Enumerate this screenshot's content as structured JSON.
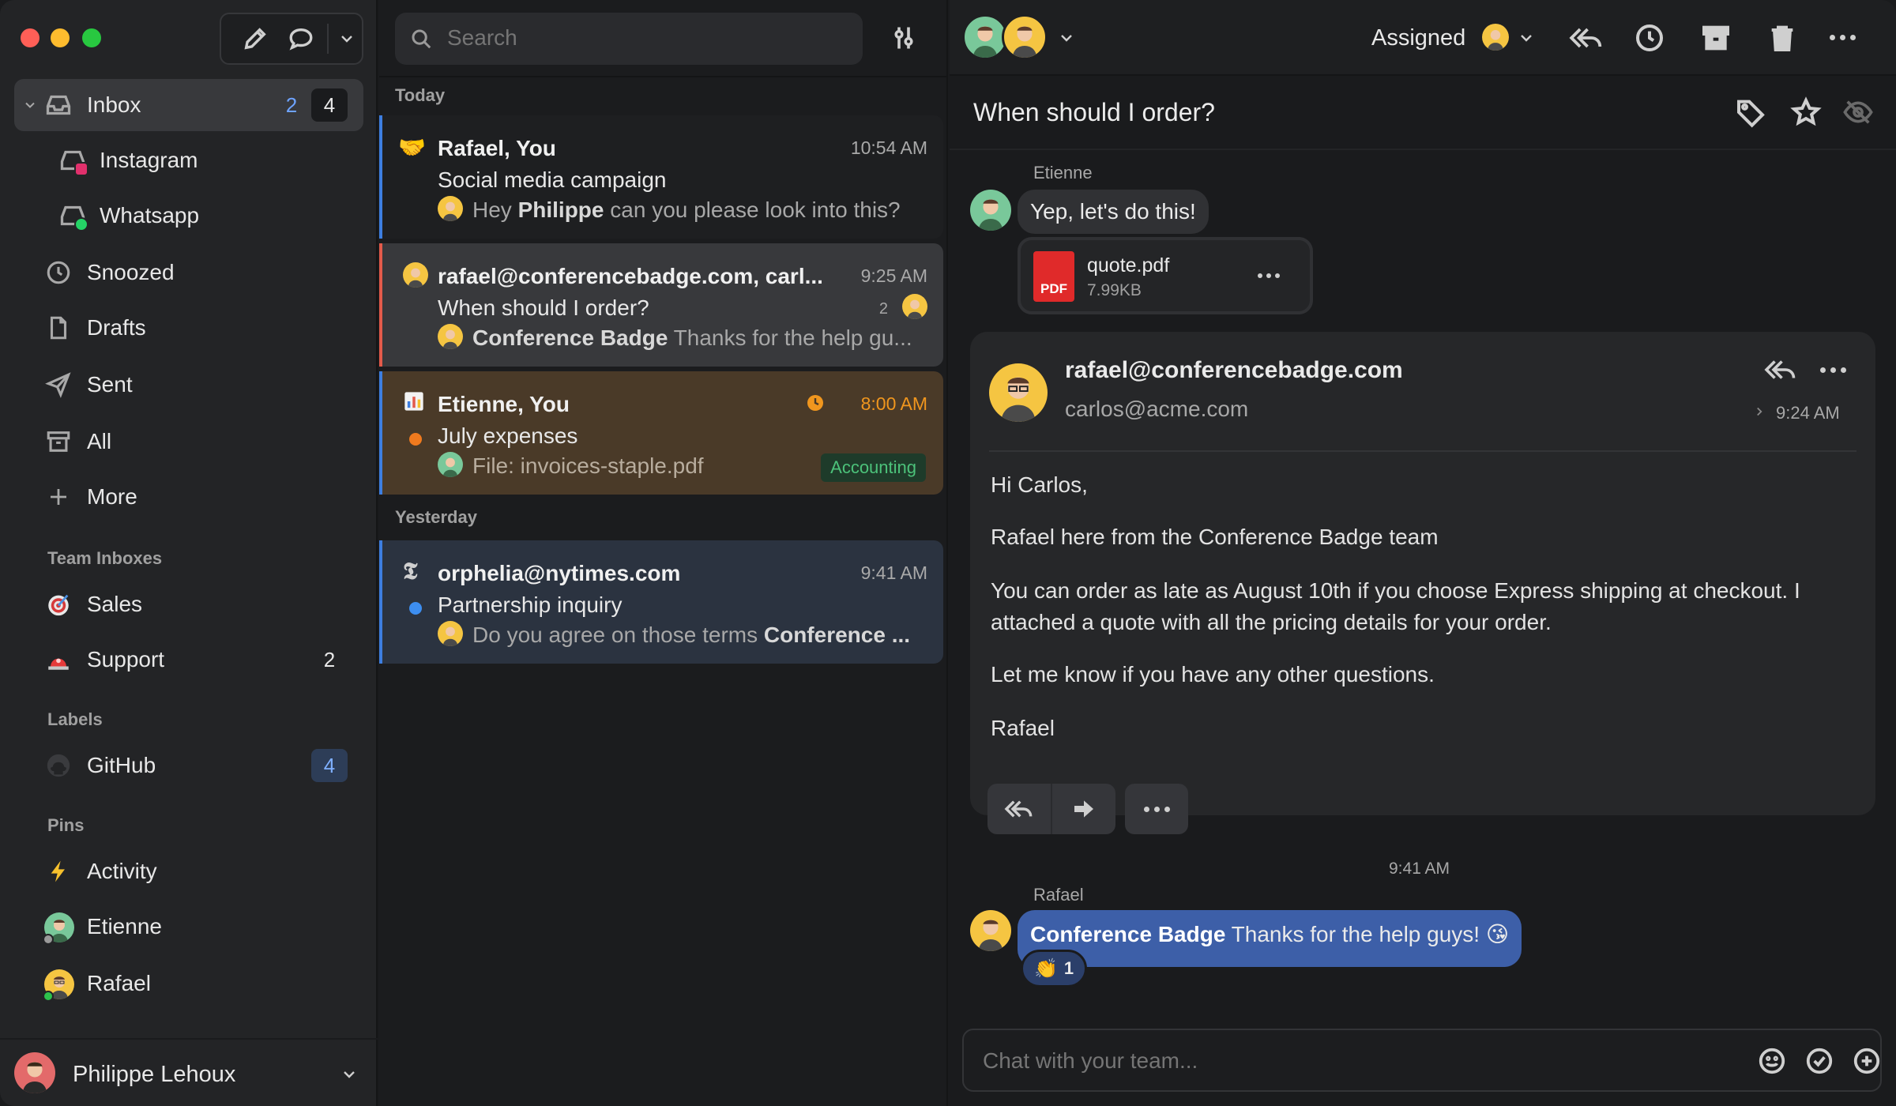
{
  "sidebar": {
    "inbox": {
      "label": "Inbox",
      "count_unassigned": "2",
      "count_total": "4"
    },
    "sub_inboxes": [
      {
        "label": "Instagram"
      },
      {
        "label": "Whatsapp"
      }
    ],
    "items": [
      {
        "label": "Snoozed"
      },
      {
        "label": "Drafts"
      },
      {
        "label": "Sent"
      },
      {
        "label": "All"
      },
      {
        "label": "More"
      }
    ],
    "team_inboxes_heading": "Team Inboxes",
    "team_inboxes": [
      {
        "label": "Sales",
        "count": ""
      },
      {
        "label": "Support",
        "count": "2"
      }
    ],
    "labels_heading": "Labels",
    "labels": [
      {
        "label": "GitHub",
        "count": "4"
      }
    ],
    "pins_heading": "Pins",
    "pins": [
      {
        "label": "Activity"
      },
      {
        "label": "Etienne"
      },
      {
        "label": "Rafael"
      }
    ],
    "account": {
      "name": "Philippe Lehoux"
    }
  },
  "list": {
    "search_placeholder": "Search",
    "today_heading": "Today",
    "yesterday_heading": "Yesterday",
    "conversations": [
      {
        "who": "Rafael, You",
        "time": "10:54 AM",
        "subject": "Social media campaign",
        "preview_pre": "Hey ",
        "preview_bold": "Philippe",
        "preview_post": " can you please look into this?"
      },
      {
        "who": "rafael@conferencebadge.com, carl...",
        "time": "9:25 AM",
        "subject": "When should I order?",
        "count": "2",
        "preview_bold": "Conference Badge",
        "preview_post": " Thanks for the help gu..."
      },
      {
        "who": "Etienne, You",
        "time": "8:00 AM",
        "subject": "July expenses",
        "preview_post": "File: invoices-staple.pdf",
        "tag": "Accounting"
      },
      {
        "who": "orphelia@nytimes.com",
        "time": "9:41 AM",
        "subject": "Partnership inquiry",
        "preview_pre": "Do you agree on those terms ",
        "preview_bold": "Conference ..."
      }
    ]
  },
  "detail": {
    "assigned_label": "Assigned",
    "subject": "When should I order?",
    "messages": {
      "etienne_name": "Etienne",
      "etienne_text": "Yep, let's do this!",
      "attachment_name": "quote.pdf",
      "attachment_size": "7.99KB",
      "attachment_badge": "PDF"
    },
    "email": {
      "from": "rafael@conferencebadge.com",
      "to": "carlos@acme.com",
      "time": "9:24 AM",
      "greeting": "Hi Carlos,",
      "p1": "Rafael here from the Conference Badge team",
      "p2": "You can order as late as August 10th if you choose Express shipping at checkout. I attached a quote with all the pricing details for your order.",
      "p3": "Let me know if you have any other questions.",
      "sign": "Rafael"
    },
    "chat": {
      "time": "9:41 AM",
      "name": "Rafael",
      "bold": "Conference Badge",
      "text": " Thanks for the help guys! 😘",
      "reaction_emoji": "👏",
      "reaction_count": "1"
    },
    "composer_placeholder": "Chat with your team..."
  },
  "colors": {
    "accent_blue": "#3d5fa8",
    "accounting_green": "#4cc27a",
    "snooze_orange": "#f0961e"
  }
}
